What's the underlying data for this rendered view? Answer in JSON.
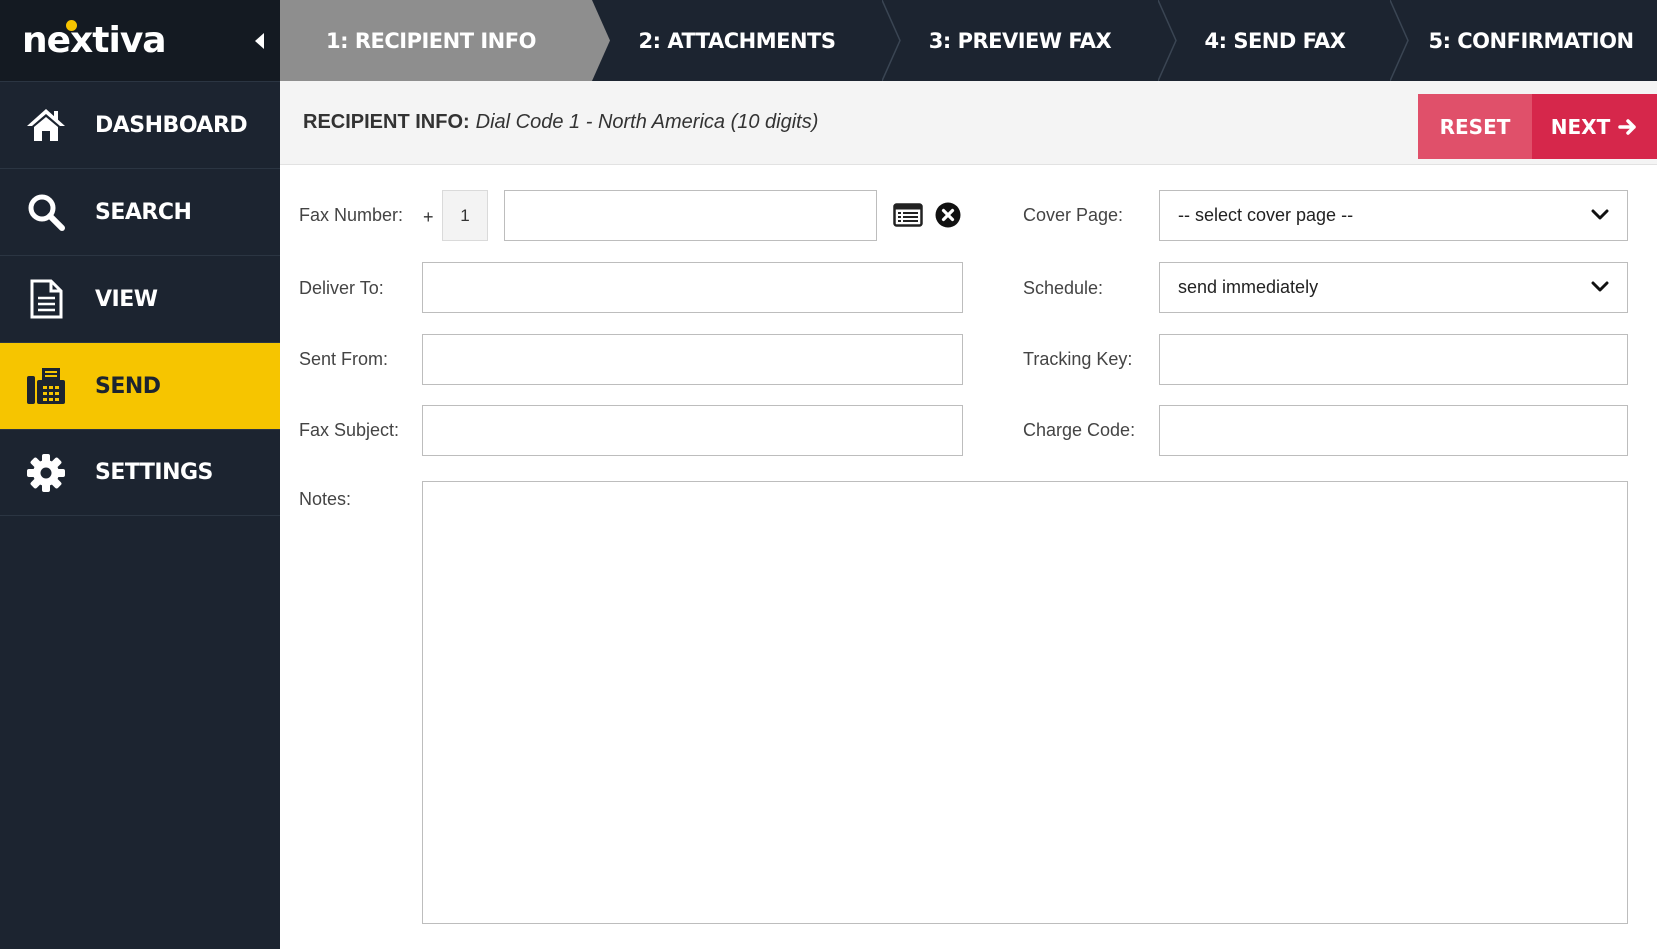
{
  "brand": {
    "logo_text": "nextiva",
    "accent": "#f6c500"
  },
  "sidebar": {
    "items": [
      {
        "label": "DASHBOARD",
        "icon": "home-icon"
      },
      {
        "label": "SEARCH",
        "icon": "search-icon"
      },
      {
        "label": "VIEW",
        "icon": "document-icon"
      },
      {
        "label": "SEND",
        "icon": "fax-icon",
        "active": true
      },
      {
        "label": "SETTINGS",
        "icon": "gear-icon"
      }
    ]
  },
  "steps": [
    {
      "label": "1: RECIPIENT INFO",
      "active": true
    },
    {
      "label": "2: ATTACHMENTS"
    },
    {
      "label": "3: PREVIEW FAX"
    },
    {
      "label": "4: SEND FAX"
    },
    {
      "label": "5: CONFIRMATION"
    }
  ],
  "header": {
    "title": "RECIPIENT INFO:",
    "subtitle": "Dial Code 1 - North America (10 digits)",
    "reset_label": "RESET",
    "next_label": "NEXT",
    "reset_color": "#e0506a",
    "next_color": "#d6274b"
  },
  "form": {
    "fax_number_label": "Fax Number:",
    "plus": "+",
    "dial_code": "1",
    "fax_number_value": "",
    "deliver_to_label": "Deliver To:",
    "deliver_to_value": "",
    "sent_from_label": "Sent From:",
    "sent_from_value": "",
    "fax_subject_label": "Fax Subject:",
    "fax_subject_value": "",
    "notes_label": "Notes:",
    "notes_value": "",
    "cover_page_label": "Cover Page:",
    "cover_page_value": "-- select cover page --",
    "schedule_label": "Schedule:",
    "schedule_value": "send immediately",
    "tracking_key_label": "Tracking Key:",
    "tracking_key_value": "",
    "charge_code_label": "Charge Code:",
    "charge_code_value": ""
  }
}
